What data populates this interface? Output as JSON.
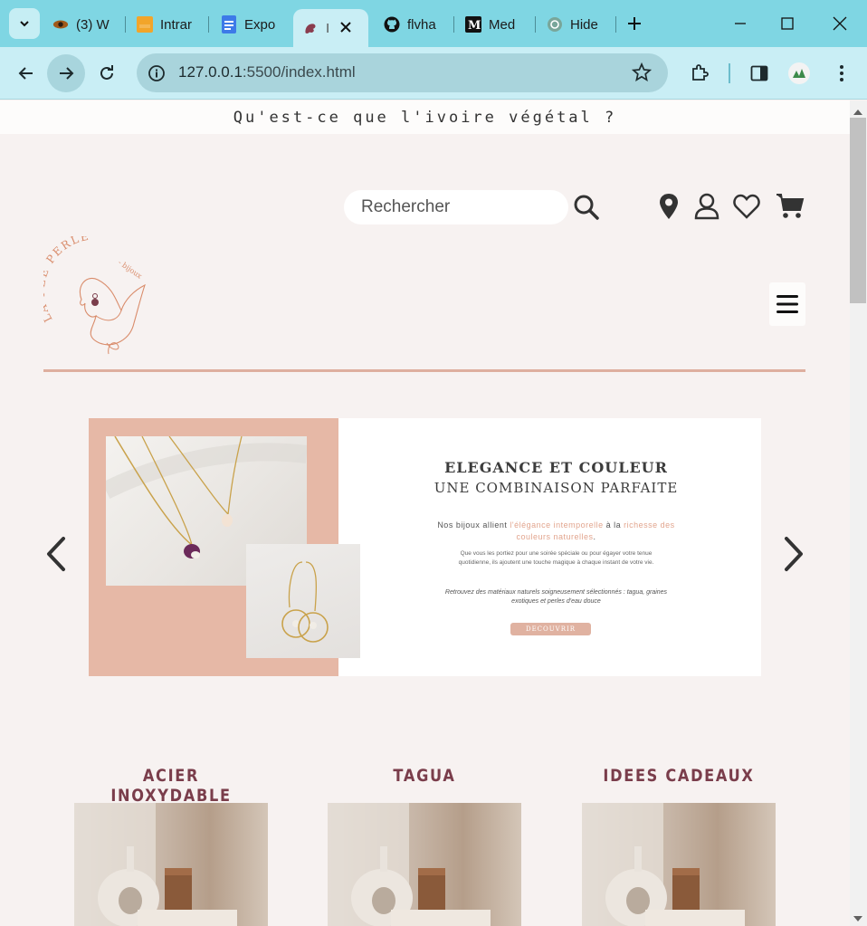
{
  "browser": {
    "tabs": [
      {
        "label": "(3) W",
        "icon": "eye-favicon"
      },
      {
        "label": "Intrar",
        "icon": "intranet-favicon"
      },
      {
        "label": "Expo",
        "icon": "docs-favicon"
      },
      {
        "label": "I",
        "icon": "fairy-favicon",
        "active": true
      },
      {
        "label": "flvha",
        "icon": "github-favicon"
      },
      {
        "label": "Med",
        "icon": "medium-favicon"
      },
      {
        "label": "Hide",
        "icon": "chatgpt-favicon"
      }
    ],
    "url_host": "127.0.0.1",
    "url_rest": ":5500/index.html",
    "colors": {
      "tabbar": "#7fd6e3",
      "toolbar": "#c9eef5"
    }
  },
  "site": {
    "announcement": "Qu'est-ce que l'ivoire végétal ?",
    "search_placeholder": "Rechercher",
    "logo_text_main": "LA FEE PERLE",
    "logo_text_sub": "- bijoux",
    "header_icons": [
      "location-icon",
      "account-icon",
      "wishlist-icon",
      "cart-icon"
    ]
  },
  "carousel": {
    "title1": "ELEGANCE ET COULEUR",
    "title2": "UNE COMBINAISON PARFAITE",
    "p1_a": "Nos bijoux allient ",
    "p1_hl1": "l'élégance intemporelle",
    "p1_b": " à la ",
    "p1_hl2": "richesse des couleurs naturelles",
    "p1_c": ".",
    "p2": "Que vous les portiez pour une soirée spéciale ou pour égayer votre tenue quotidienne, ils ajoutent une touche magique à chaque instant de votre vie.",
    "p3": "Retrouvez des matériaux naturels soigneusement sélectionnés : tagua, graines exotiques et perles d'eau douce",
    "button": "DECOUVRIR",
    "colors": {
      "accent": "#e6b8a6",
      "highlight": "#e2a58e"
    }
  },
  "categories": [
    {
      "title": "ACIER INOXYDABLE"
    },
    {
      "title": "TAGUA"
    },
    {
      "title": "IDEES CADEAUX"
    }
  ],
  "colors": {
    "brand_dark": "#7a3d4b",
    "divider": "#deaf9f",
    "page_bg": "#f7f2f1"
  }
}
